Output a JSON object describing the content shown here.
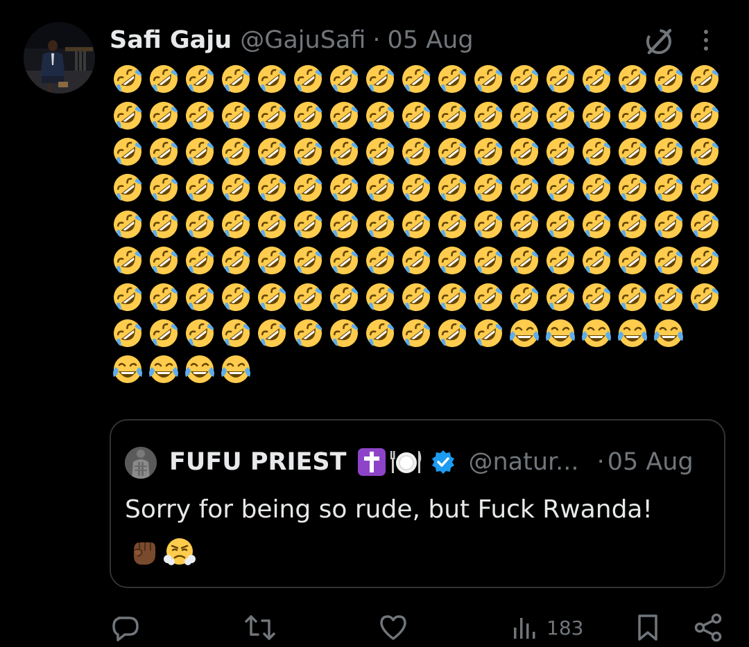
{
  "post": {
    "author_name": "Safi Gaju",
    "author_handle": "@GajuSafi",
    "separator": "·",
    "date": "05 Aug",
    "emoji_rows": [
      [
        "rofl",
        "rofl",
        "rofl",
        "rofl",
        "rofl",
        "rofl",
        "rofl",
        "rofl",
        "rofl",
        "rofl",
        "rofl",
        "rofl",
        "rofl",
        "rofl",
        "rofl",
        "rofl",
        "rofl"
      ],
      [
        "rofl",
        "rofl",
        "rofl",
        "rofl",
        "rofl",
        "rofl",
        "rofl",
        "rofl",
        "rofl",
        "rofl",
        "rofl",
        "rofl",
        "rofl",
        "rofl",
        "rofl",
        "rofl",
        "rofl"
      ],
      [
        "rofl",
        "rofl",
        "rofl",
        "rofl",
        "rofl",
        "rofl",
        "rofl",
        "rofl",
        "rofl",
        "rofl",
        "rofl",
        "rofl",
        "rofl",
        "rofl",
        "rofl",
        "rofl",
        "rofl"
      ],
      [
        "rofl",
        "rofl",
        "rofl",
        "rofl",
        "rofl",
        "rofl",
        "rofl",
        "rofl",
        "rofl",
        "rofl",
        "rofl",
        "rofl",
        "rofl",
        "rofl",
        "rofl",
        "rofl",
        "rofl"
      ],
      [
        "rofl",
        "rofl",
        "rofl",
        "rofl",
        "rofl",
        "rofl",
        "rofl",
        "rofl",
        "rofl",
        "rofl",
        "rofl",
        "rofl",
        "rofl",
        "rofl",
        "rofl",
        "rofl",
        "rofl"
      ],
      [
        "rofl",
        "rofl",
        "rofl",
        "rofl",
        "rofl",
        "rofl",
        "rofl",
        "rofl",
        "rofl",
        "rofl",
        "rofl",
        "rofl",
        "rofl",
        "rofl",
        "rofl",
        "rofl",
        "rofl"
      ],
      [
        "rofl",
        "rofl",
        "rofl",
        "rofl",
        "rofl",
        "rofl",
        "rofl",
        "rofl",
        "rofl",
        "rofl",
        "rofl",
        "rofl",
        "rofl",
        "rofl",
        "rofl",
        "rofl",
        "rofl"
      ],
      [
        "rofl",
        "rofl",
        "rofl",
        "rofl",
        "rofl",
        "rofl",
        "rofl",
        "rofl",
        "rofl",
        "rofl",
        "rofl",
        "joy",
        "joy",
        "joy",
        "joy",
        "joy"
      ],
      [
        "joy",
        "joy",
        "joy",
        "joy"
      ]
    ]
  },
  "quoted_post": {
    "author_name": "FUFU PRIEST",
    "author_handle": "@natur...",
    "separator": "·",
    "date": "05 Aug",
    "text": "Sorry for being so rude, but Fuck Rwanda!",
    "trailing_emojis": [
      "raised-fist-dark",
      "triumph-face"
    ]
  },
  "actions": {
    "reply_icon": "reply-icon",
    "repost_icon": "repost-icon",
    "like_icon": "like-icon",
    "views_icon": "views-icon",
    "views_count": "183",
    "bookmark_icon": "bookmark-icon",
    "share_icon": "share-icon"
  },
  "colors": {
    "background": "#000000",
    "primary_text": "#e7e9ea",
    "secondary_text": "#71767b",
    "border": "#2f3336",
    "verified_blue": "#1d9bf0",
    "cross_purple": "#8e44c8",
    "emoji_yellow": "#ffcc4d",
    "tear_blue": "#5dadec"
  }
}
